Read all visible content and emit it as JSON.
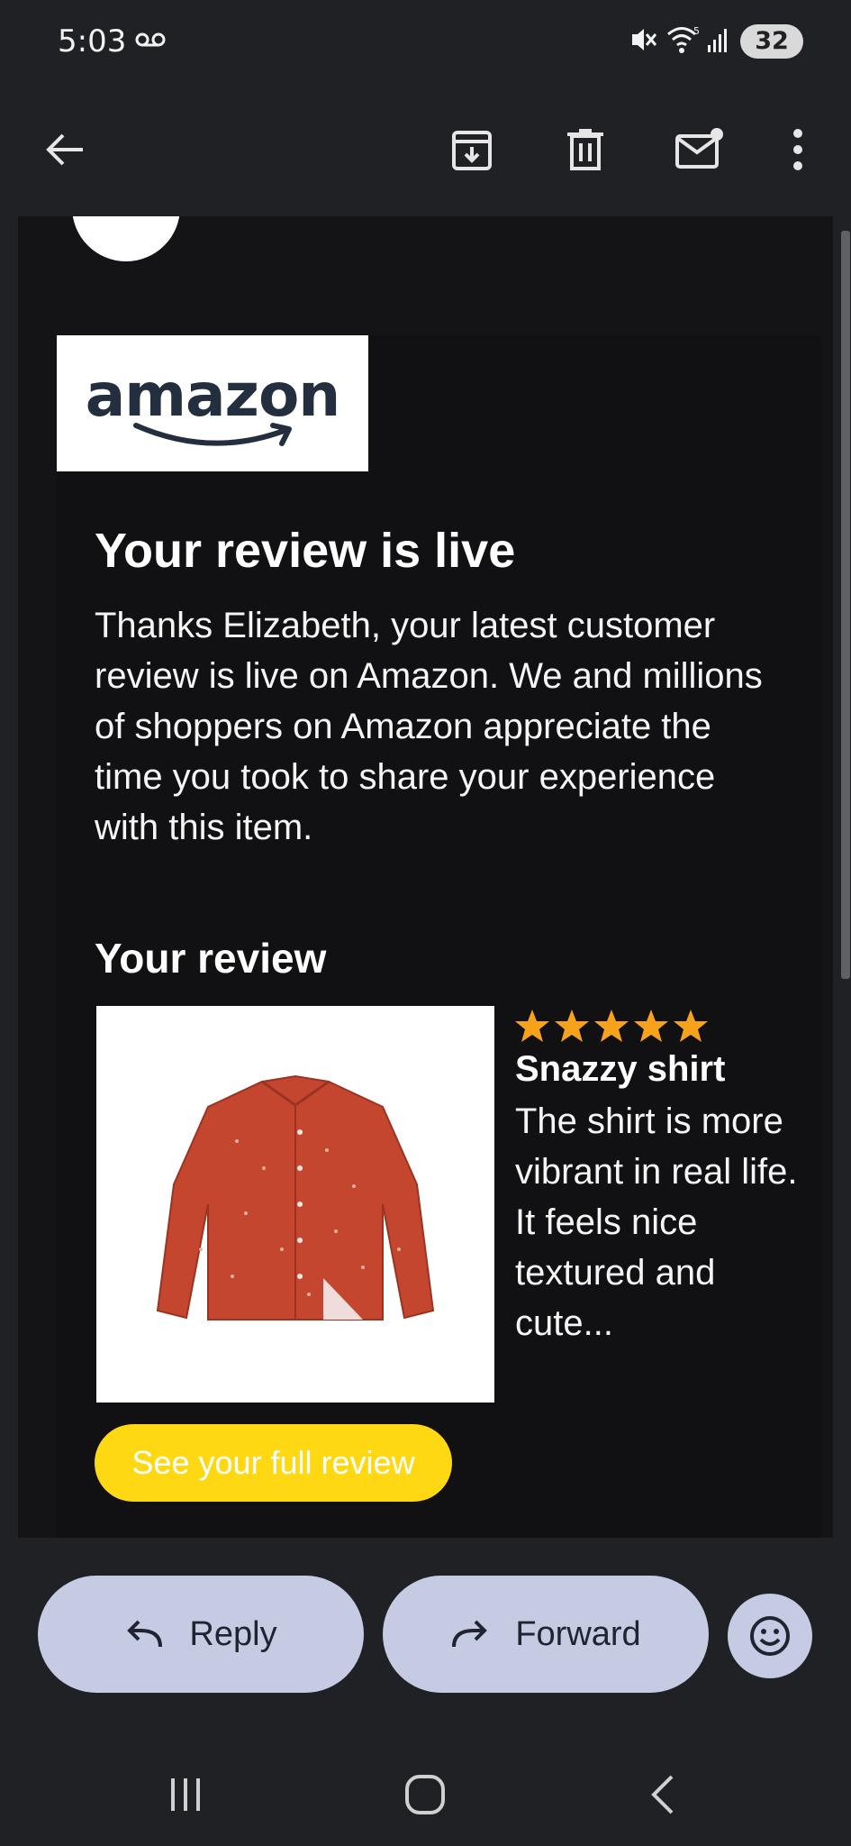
{
  "status_bar": {
    "time": "5:03",
    "battery": "32",
    "icons": [
      "voicemail-icon",
      "mute-icon",
      "wifi-icon",
      "signal-icon",
      "battery-icon"
    ]
  },
  "toolbar": {
    "icons": [
      "back-arrow-icon",
      "archive-icon",
      "delete-icon",
      "mark-unread-icon",
      "more-options-icon"
    ]
  },
  "email": {
    "logo_text": "amazon",
    "headline": "Your review is live",
    "body": "Thanks Elizabeth, your latest customer review is live on Amazon. We and millions of shoppers on Amazon appreciate the time you took to share your experience with this item.",
    "section_title": "Your review",
    "review": {
      "rating": 5,
      "rating_max": 5,
      "title": "Snazzy shirt",
      "snippet": "The shirt is more vibrant in real life. It feels nice textured and cute..."
    },
    "cta_label": "See your full review",
    "colors": {
      "star": "#f7a21b",
      "cta": "#ffd814",
      "logo_text": "#232f3e",
      "smile": "#232f3e",
      "shirt": "#c4462f"
    }
  },
  "actions": {
    "reply_label": "Reply",
    "forward_label": "Forward",
    "emoji_icon": "emoji-reaction-icon"
  },
  "nav": {
    "icons": [
      "recent-apps-icon",
      "home-icon",
      "back-icon"
    ]
  }
}
